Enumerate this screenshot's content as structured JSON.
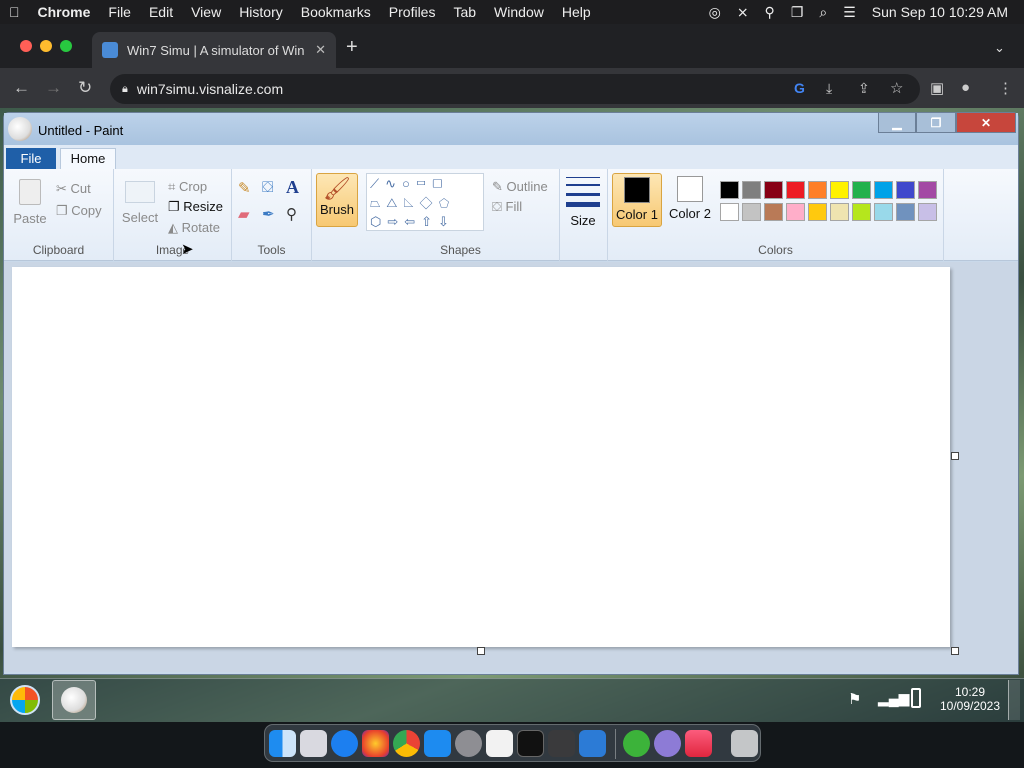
{
  "menubar": {
    "app": "Chrome",
    "items": [
      "File",
      "Edit",
      "View",
      "History",
      "Bookmarks",
      "Profiles",
      "Tab",
      "Window",
      "Help"
    ],
    "datetime": "Sun Sep 10  10:29 AM"
  },
  "browser": {
    "tab_title": "Win7 Simu | A simulator of Win",
    "url": "win7simu.visnalize.com"
  },
  "paint": {
    "window_title": "Untitled - Paint",
    "tabs": {
      "file": "File",
      "home": "Home"
    },
    "clipboard": {
      "paste": "Paste",
      "cut": "Cut",
      "copy": "Copy",
      "label": "Clipboard"
    },
    "image": {
      "select": "Select",
      "crop": "Crop",
      "resize": "Resize",
      "rotate": "Rotate",
      "label": "Image"
    },
    "tools": {
      "label": "Tools"
    },
    "brush": {
      "label": "Brush"
    },
    "shapes": {
      "outline": "Outline",
      "fill": "Fill",
      "label": "Shapes"
    },
    "size": {
      "label": "Size"
    },
    "colors": {
      "color1": "Color 1",
      "color2": "Color 2",
      "label": "Colors",
      "color1_value": "#000000",
      "color2_value": "#ffffff",
      "palette_row1": [
        "#000000",
        "#7f7f7f",
        "#880015",
        "#ed1c24",
        "#ff7f27",
        "#fff200",
        "#22b14c",
        "#00a2e8",
        "#3f48cc",
        "#a349a4"
      ],
      "palette_row2": [
        "#ffffff",
        "#c3c3c3",
        "#b97a57",
        "#ffaec9",
        "#ffc90e",
        "#efe4b0",
        "#b5e61d",
        "#99d9ea",
        "#7092be",
        "#c8bfe7"
      ]
    }
  },
  "taskbar": {
    "time": "10:29",
    "date": "10/09/2023"
  }
}
